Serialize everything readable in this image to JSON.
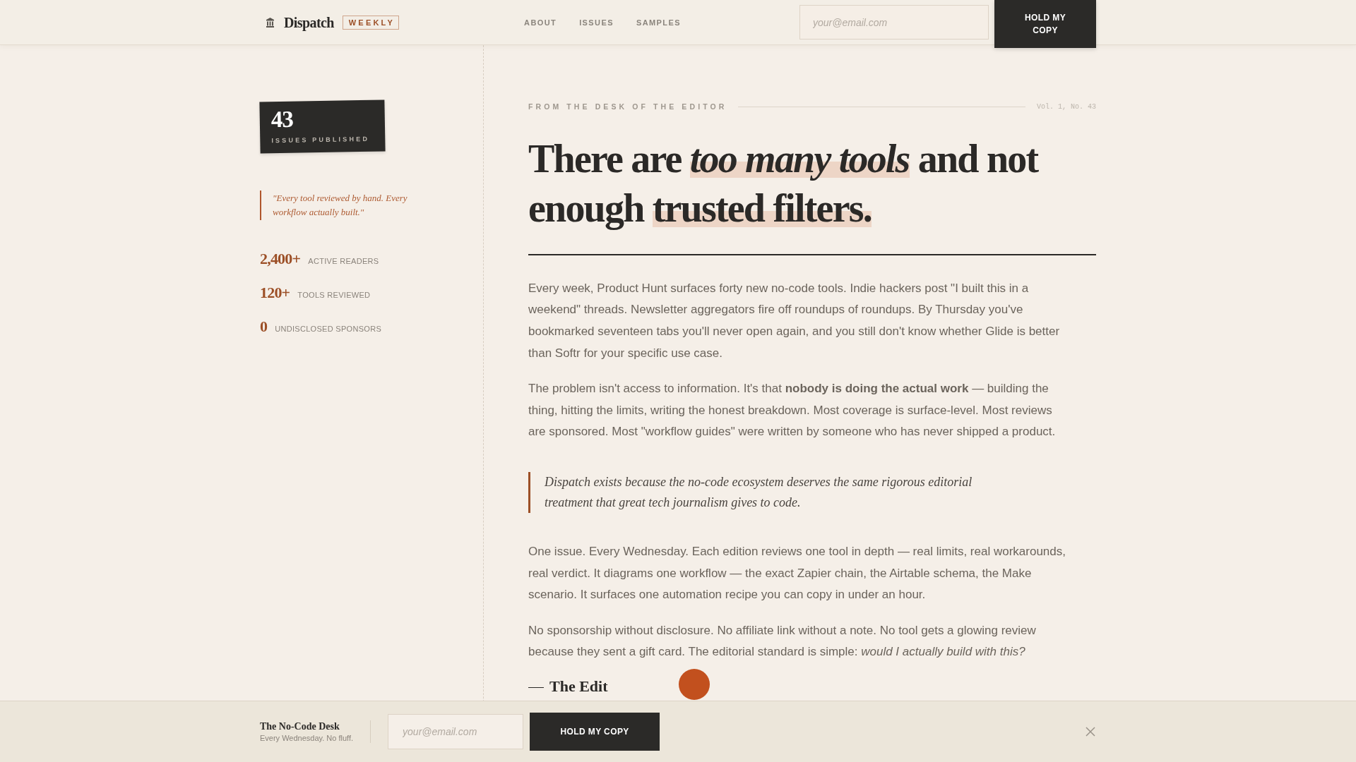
{
  "header": {
    "brand": "Dispatch",
    "badge": "WEEKLY",
    "nav": [
      {
        "label": "ABOUT"
      },
      {
        "label": "ISSUES"
      },
      {
        "label": "SAMPLES"
      }
    ],
    "email": {
      "placeholder": "your@email.com"
    },
    "button": "HOLD MY COPY"
  },
  "sidebar": {
    "issue_card": {
      "count": "43",
      "label": "ISSUES PUBLISHED"
    },
    "quote": "\"Every tool reviewed by hand. Every workflow actually built.\"",
    "stats": [
      {
        "value": "2,400+",
        "label": "ACTIVE READERS"
      },
      {
        "value": "120+",
        "label": "TOOLS REVIEWED"
      },
      {
        "value": "0",
        "label": "UNDISCLOSED SPONSORS"
      }
    ]
  },
  "article": {
    "eyebrow": "FROM THE DESK OF THE EDITOR",
    "issue_ref": "Vol. 1, No. 43",
    "headline": [
      {
        "text": "There are ",
        "italic": false,
        "highlighted": false
      },
      {
        "text": "too many tools",
        "italic": true,
        "highlighted": true
      },
      {
        "text": " and not enough ",
        "italic": false,
        "highlighted": false
      },
      {
        "text": "trusted filters.",
        "italic": false,
        "highlighted": true
      }
    ],
    "paragraphs": [
      "Every week, Product Hunt surfaces forty new no-code tools. Indie hackers post \"I built this in a weekend\" threads. Newsletter aggregators fire off roundups of roundups. By Thursday you've bookmarked seventeen tabs you'll never open again, and you still don't know whether Glide is better than Softr for your specific use case.",
      "The problem isn't access to information. It's that **nobody is doing the actual work** — building the thing, hitting the limits, writing the honest breakdown. Most coverage is surface-level. Most reviews are sponsored. Most \"workflow guides\" were written by someone who has never shipped a product."
    ],
    "pull_quote": "Dispatch exists because the no-code ecosystem deserves the same rigorous editorial treatment that great tech journalism gives to code.",
    "paragraphs_after": [
      "One issue. Every Wednesday. Each edition reviews one tool in depth — real limits, real workarounds, real verdict. It diagrams one workflow — the exact Zapier chain, the Airtable schema, the Make scenario. It surfaces one automation recipe you can copy in under an hour.",
      "No sponsorship without disclosure. No affiliate link without a note. No tool gets a glowing review because they sent a gift card. The editorial standard is simple: *would I actually build with this?*"
    ],
    "signature": {
      "name": "The Edit"
    }
  },
  "subscribe_bar": {
    "title": "The No-Code Desk",
    "subtitle": "Every Wednesday. No fluff.",
    "email": {
      "placeholder": "your@email.com"
    },
    "button": "HOLD MY COPY"
  }
}
